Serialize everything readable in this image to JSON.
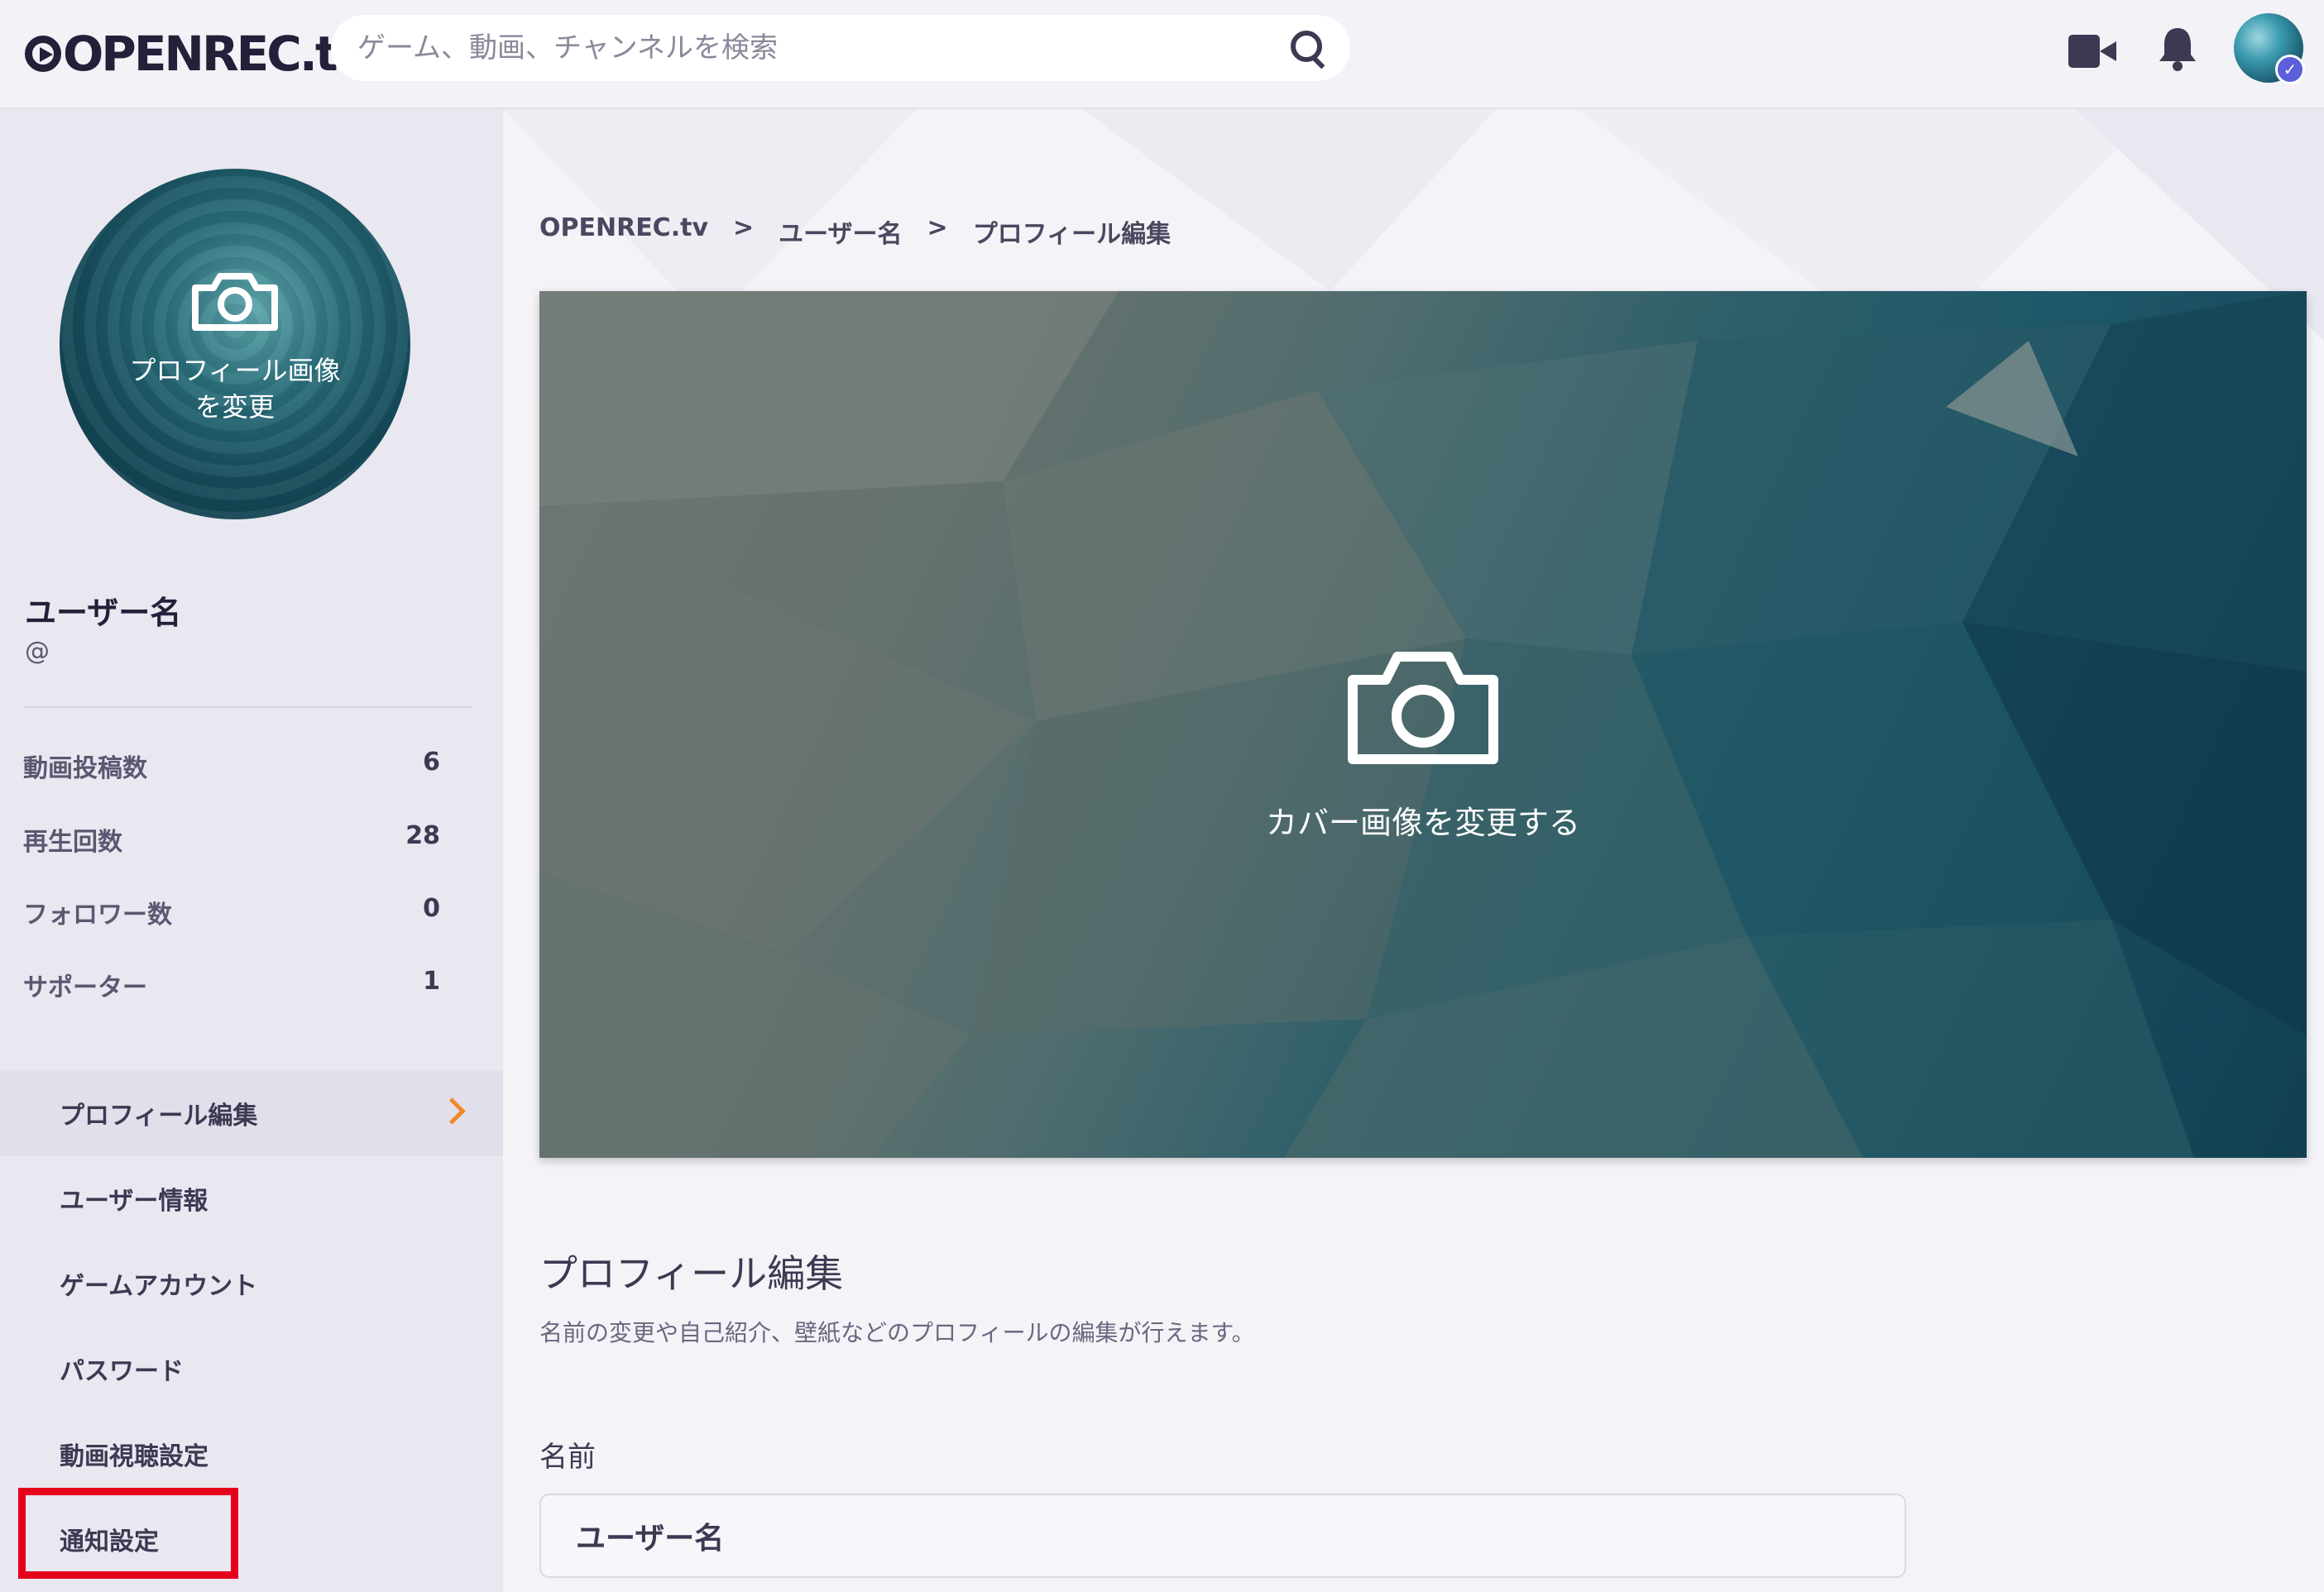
{
  "header": {
    "logo": "OPENREC.tv",
    "search_placeholder": "ゲーム、動画、チャンネルを検索"
  },
  "sidebar": {
    "profile_image_label_line1": "プロフィール画像",
    "profile_image_label_line2": "を変更",
    "user_name": "ユーザー名",
    "user_handle": "@",
    "stats": [
      {
        "label": "動画投稿数",
        "value": "6"
      },
      {
        "label": "再生回数",
        "value": "28"
      },
      {
        "label": "フォロワー数",
        "value": "0"
      },
      {
        "label": "サポーター",
        "value": "1"
      }
    ],
    "menu": [
      {
        "label": "プロフィール編集",
        "active": true
      },
      {
        "label": "ユーザー情報"
      },
      {
        "label": "ゲームアカウント"
      },
      {
        "label": "パスワード"
      },
      {
        "label": "動画視聴設定"
      },
      {
        "label": "通知設定"
      }
    ]
  },
  "breadcrumb": [
    "OPENREC.tv",
    ">",
    "ユーザー名",
    ">",
    "プロフィール編集"
  ],
  "cover": {
    "label": "カバー画像を変更する"
  },
  "section": {
    "title": "プロフィール編集",
    "description": "名前の変更や自己紹介、壁紙などのプロフィールの編集が行えます。"
  },
  "form": {
    "name_label": "名前",
    "name_value": "ユーザー名"
  },
  "colors": {
    "accent_chevron": "#f0892a",
    "highlight": "#e5001c",
    "verified": "#5b5fd9"
  }
}
